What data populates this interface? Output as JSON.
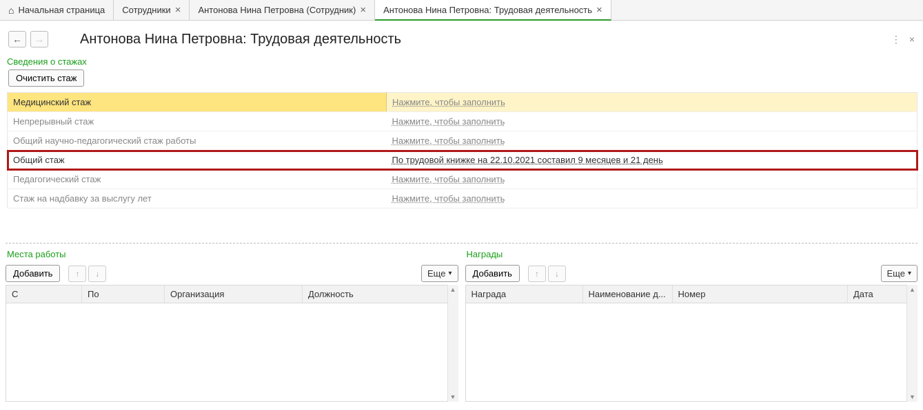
{
  "tabs": [
    {
      "label": "Начальная страница",
      "closable": false,
      "home": true
    },
    {
      "label": "Сотрудники",
      "closable": true
    },
    {
      "label": "Антонова Нина Петровна (Сотрудник)",
      "closable": true
    },
    {
      "label": "Антонова Нина Петровна: Трудовая деятельность",
      "closable": true,
      "active": true
    }
  ],
  "page_title": "Антонова Нина Петровна: Трудовая деятельность",
  "sections": {
    "stages": {
      "title": "Сведения о стажах",
      "clear_button": "Очистить стаж",
      "fill_placeholder": "Нажмите, чтобы заполнить",
      "rows": [
        {
          "name": "Медицинский стаж",
          "value": null,
          "selected": true
        },
        {
          "name": "Непрерывный стаж",
          "value": null
        },
        {
          "name": "Общий научно-педагогический стаж работы",
          "value": null
        },
        {
          "name": "Общий стаж",
          "value": "По трудовой книжке на 22.10.2021 составил 9 месяцев и 21 день",
          "highlight": true
        },
        {
          "name": "Педагогический стаж",
          "value": null
        },
        {
          "name": "Стаж на надбавку за выслугу лет",
          "value": null
        }
      ]
    },
    "workplaces": {
      "title": "Места работы",
      "add_button": "Добавить",
      "more_button": "Еще",
      "columns": [
        "С",
        "По",
        "Организация",
        "Должность"
      ]
    },
    "awards": {
      "title": "Награды",
      "add_button": "Добавить",
      "more_button": "Еще",
      "columns": [
        "Награда",
        "Наименование д...",
        "Номер",
        "Дата"
      ]
    }
  }
}
